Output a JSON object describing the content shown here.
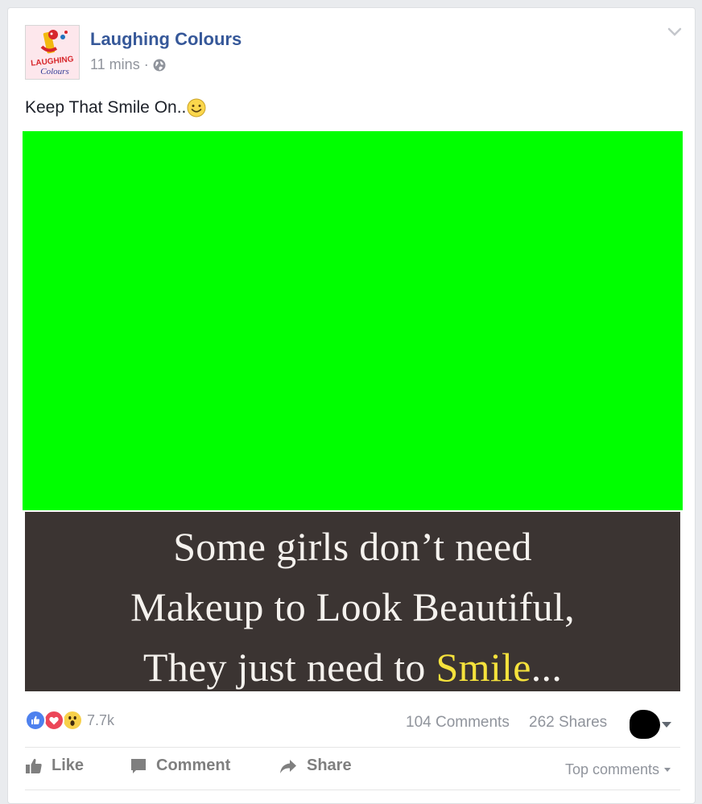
{
  "post": {
    "page_name": "Laughing Colours",
    "timestamp": "11 mins",
    "separator": "·",
    "privacy_icon": "globe-icon",
    "text": "Keep That Smile On..",
    "text_emoji": "smile-icon"
  },
  "avatar": {
    "logo_line1": "LAUGHING",
    "logo_line2": "Colours"
  },
  "image": {
    "placeholder_color": "#00ff00",
    "quote_lines": [
      "Some girls don’t need",
      "Makeup to Look Beautiful,"
    ],
    "quote_line3_prefix": "They just need to ",
    "quote_line3_highlight": "Smile",
    "quote_line3_suffix": "..."
  },
  "reactions": {
    "icons": [
      "like-reaction-icon",
      "love-reaction-icon",
      "wow-reaction-icon"
    ],
    "count": "7.7k"
  },
  "stats": {
    "comments": "104 Comments",
    "shares": "262 Shares"
  },
  "actions": {
    "like": "Like",
    "comment": "Comment",
    "share": "Share",
    "top_comments": "Top comments"
  },
  "colors": {
    "link_blue": "#365899",
    "meta_gray": "#90949c",
    "like_blue": "#4e81ee",
    "love_red": "#ec4759",
    "wow_yellow": "#f7d04a",
    "quote_background": "#3b3432",
    "quote_highlight": "#f5e23c"
  }
}
